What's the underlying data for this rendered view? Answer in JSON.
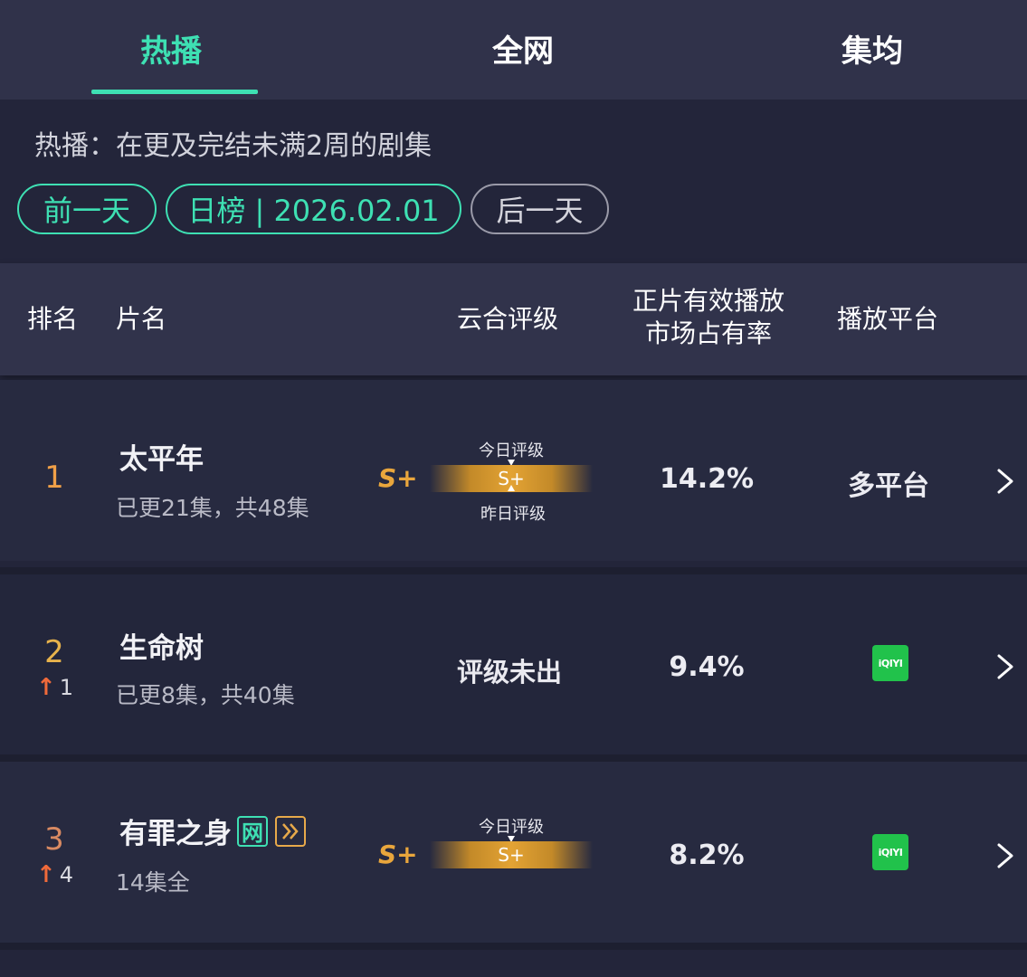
{
  "tabs": {
    "items": [
      {
        "label": "热播"
      },
      {
        "label": "全网"
      },
      {
        "label": "集均"
      }
    ],
    "active_index": 0
  },
  "filter": {
    "description": "热播：在更及完结未满2周的剧集",
    "prev_label": "前一天",
    "date_label": "日榜 | 2026.02.01",
    "next_label": "后一天"
  },
  "table": {
    "headers": {
      "rank": "排名",
      "name": "片名",
      "grade": "云合评级",
      "share_line1": "正片有效播放",
      "share_line2": "市场占有率",
      "platform": "播放平台"
    },
    "grade_today_label": "今日评级",
    "grade_yesterday_label": "昨日评级",
    "rows": [
      {
        "rank": "1",
        "change": "",
        "title": "太平年",
        "subtitle": "已更21集，共48集",
        "grade": "S+",
        "grade_bar": "S+",
        "share": "14.2%",
        "platform": "多平台"
      },
      {
        "rank": "2",
        "change": "1",
        "title": "生命树",
        "subtitle": "已更8集，共40集",
        "grade_status": "评级未出",
        "share": "9.4%",
        "platform_logo": "iQIYI"
      },
      {
        "rank": "3",
        "change": "4",
        "title": "有罪之身",
        "badge_net": "网",
        "subtitle": "14集全",
        "grade": "S+",
        "grade_bar": "S+",
        "share": "8.2%",
        "platform_logo": "iQIYI"
      }
    ]
  },
  "colors": {
    "accent": "#3ee0b3",
    "grade_gold": "#e9a63c",
    "rank1": "#f0a048",
    "rank2": "#e8b34c",
    "rank3": "#d98a62",
    "up_arrow": "#f06a3a",
    "iqiyi_green": "#21c24b"
  },
  "icons": {
    "up_arrow": "up-arrow-icon",
    "chevron": "chevron-right-icon",
    "fast_forward_badge": "fast-forward-icon"
  }
}
